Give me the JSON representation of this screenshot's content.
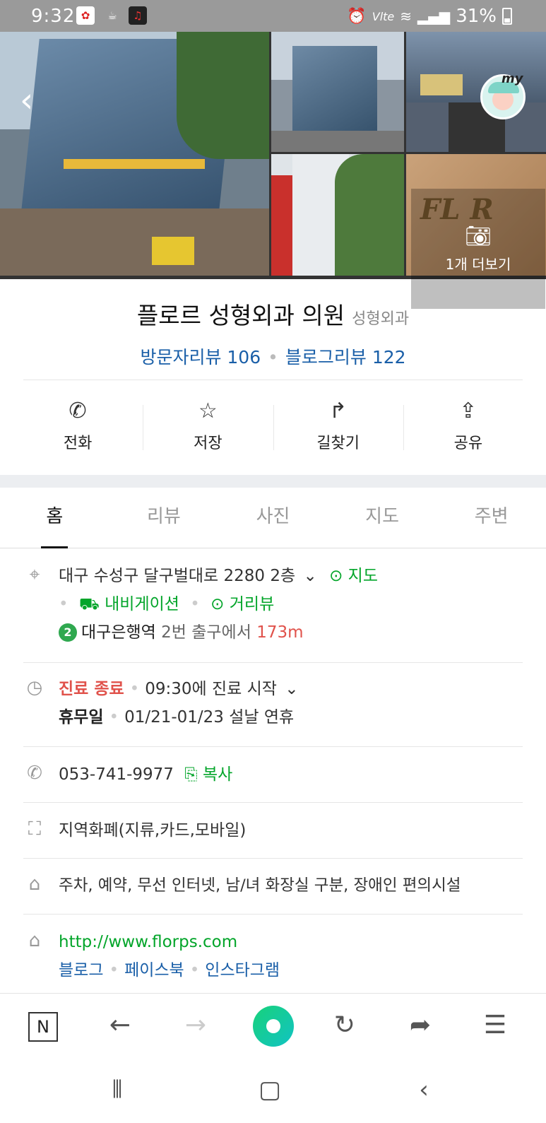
{
  "status_bar": {
    "time": "9:32",
    "battery": "31%",
    "network": "Vlte"
  },
  "gallery": {
    "more_label": "1개 더보기"
  },
  "place": {
    "name": "플로르 성형외과 의원",
    "category": "성형외과",
    "visitor_reviews": "방문자리뷰 106",
    "blog_reviews": "블로그리뷰 122"
  },
  "actions": [
    {
      "label": "전화",
      "icon": "phone-icon"
    },
    {
      "label": "저장",
      "icon": "star-icon"
    },
    {
      "label": "길찾기",
      "icon": "directions-icon"
    },
    {
      "label": "공유",
      "icon": "share-icon"
    }
  ],
  "tabs": [
    "홈",
    "리뷰",
    "사진",
    "지도",
    "주변"
  ],
  "address": {
    "text": "대구 수성구 달구벌대로 2280 2층",
    "map_link": "지도",
    "navigation_link": "내비게이션",
    "streetview_link": "거리뷰",
    "subway_line": "2",
    "station": "대구은행역",
    "exit_text": "2번 출구에서",
    "distance": "173m"
  },
  "hours": {
    "status": "진료 종료",
    "next": "09:30에 진료 시작",
    "holiday_label": "휴무일",
    "holiday_text": "01/21-01/23 설날 연휴"
  },
  "phone": {
    "number": "053-741-9977",
    "copy_label": "복사"
  },
  "payment": {
    "text": "지역화폐(지류,카드,모바일)"
  },
  "facilities": {
    "text": "주차, 예약, 무선 인터넷, 남/녀 화장실 구분, 장애인 편의시설"
  },
  "website": {
    "url": "http://www.florps.com",
    "links": [
      "블로그",
      "페이스북",
      "인스타그램"
    ]
  },
  "colors": {
    "green": "#03a52a",
    "red": "#e0524b",
    "blue": "#1a5fa8"
  }
}
